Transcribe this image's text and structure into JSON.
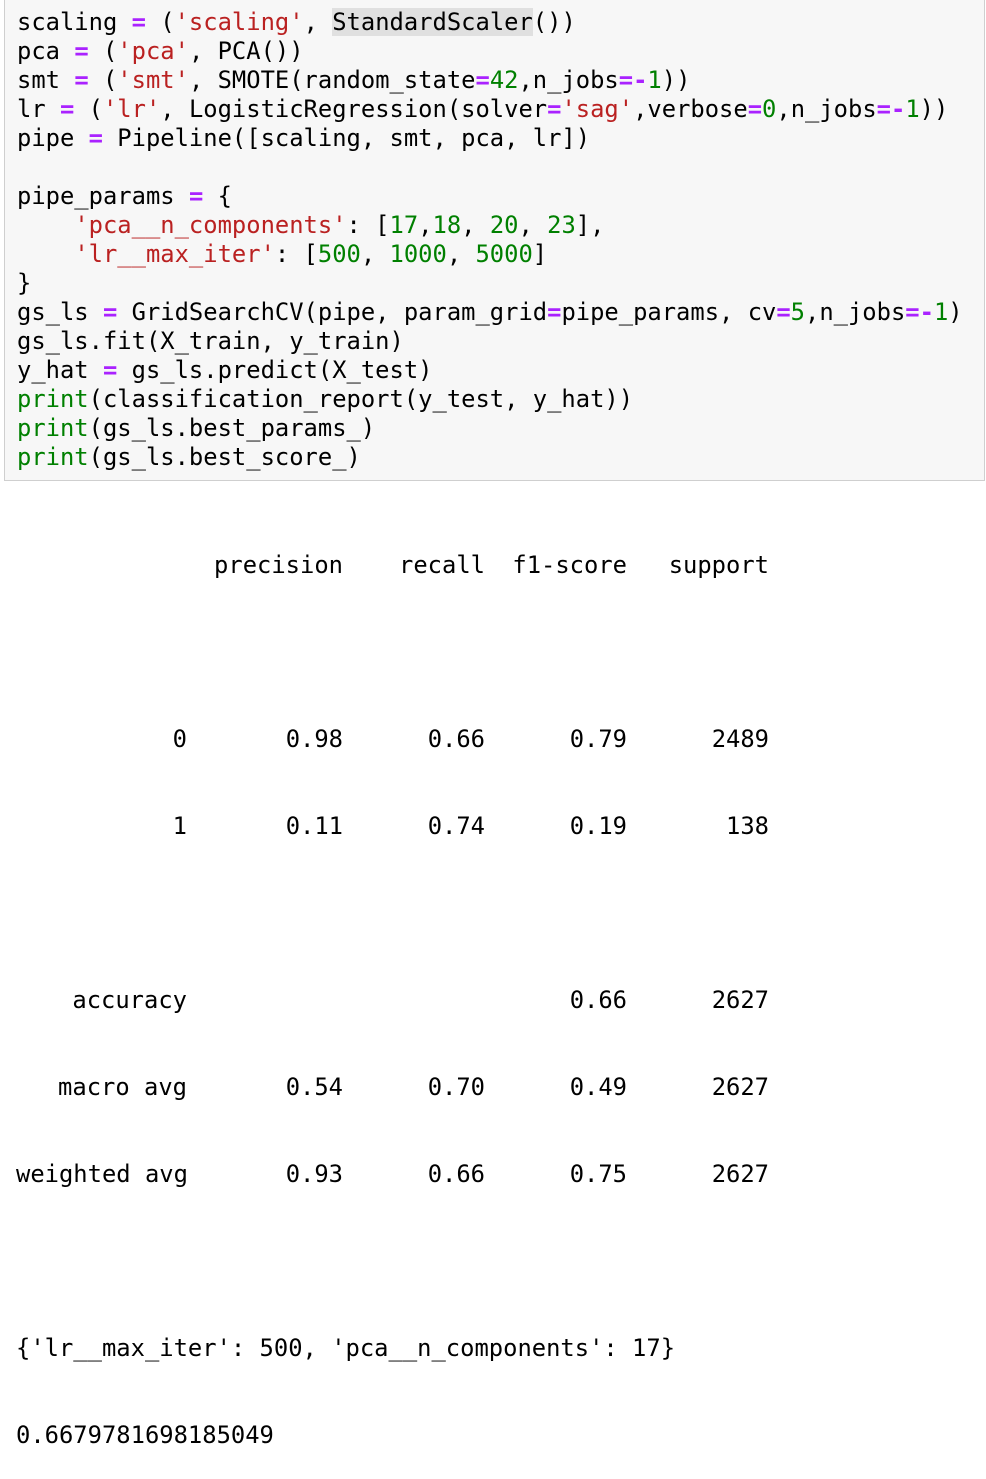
{
  "code": {
    "scaling": {
      "var": "scaling",
      "eq": "=",
      "open": " (",
      "str": "'scaling'",
      "sep": ", ",
      "obj": "StandardScaler",
      "close": "())"
    },
    "pca": {
      "var": "pca",
      "eq": "=",
      "open": " (",
      "str": "'pca'",
      "sep": ", ",
      "rest": "PCA())"
    },
    "smt": {
      "var": "smt",
      "eq": "=",
      "open": " (",
      "str": "'smt'",
      "sep": ", ",
      "call": "SMOTE(random_state",
      "eq2": "=",
      "num1": "42",
      "mid": ",n_jobs",
      "eq3": "=-",
      "num2": "1",
      "close": "))"
    },
    "lr": {
      "var": "lr",
      "eq": "=",
      "open": " (",
      "str": "'lr'",
      "sep": ", ",
      "call": "LogisticRegression(solver",
      "eq2": "=",
      "str2": "'sag'",
      "mid": ",verbose",
      "eq3": "=",
      "num1": "0",
      "mid2": ",n_jobs",
      "eq4": "=-",
      "num2": "1",
      "close": "))"
    },
    "pipe": {
      "var": "pipe",
      "eq": "=",
      "rest": " Pipeline([scaling, smt, pca, lr])"
    },
    "pipe_params_open": {
      "var": "pipe_params",
      "eq": "=",
      "rest": " {"
    },
    "param1": {
      "key": "'pca__n_components'",
      "colon": ": [",
      "v1": "17",
      "c1": ",",
      "v2": "18",
      "c2": ", ",
      "v3": "20",
      "c3": ", ",
      "v4": "23",
      "close": "],"
    },
    "param2": {
      "key": "'lr__max_iter'",
      "colon": ": [",
      "v1": "500",
      "c1": ", ",
      "v2": "1000",
      "c2": ", ",
      "v3": "5000",
      "close": "]"
    },
    "brace_close": "}",
    "gs": {
      "var": "gs_ls",
      "eq": "=",
      "call": " GridSearchCV(pipe, param_grid",
      "eq2": "=",
      "mid": "pipe_params, cv",
      "eq3": "=",
      "num1": "5",
      "mid2": ",n_jobs",
      "eq4": "=-",
      "num2": "1",
      "close": ")"
    },
    "fit": "gs_ls.fit(X_train, y_train)",
    "yhat": {
      "var": "y_hat",
      "eq": "=",
      "rest": " gs_ls.predict(X_test)"
    },
    "print1": {
      "kw": "print",
      "rest": "(classification_report(y_test, y_hat))"
    },
    "print2": {
      "kw": "print",
      "rest": "(gs_ls.best_params_)"
    },
    "print3": {
      "kw": "print",
      "rest": "(gs_ls.best_score_)"
    }
  },
  "report": {
    "headers": [
      "",
      "precision",
      "recall",
      "f1-score",
      "support"
    ],
    "rows": [
      [
        "0",
        "0.98",
        "0.66",
        "0.79",
        "2489"
      ],
      [
        "1",
        "0.11",
        "0.74",
        "0.19",
        "138"
      ],
      [
        "accuracy",
        "",
        "",
        "0.66",
        "2627"
      ],
      [
        "macro avg",
        "0.54",
        "0.70",
        "0.49",
        "2627"
      ],
      [
        "weighted avg",
        "0.93",
        "0.66",
        "0.75",
        "2627"
      ]
    ]
  },
  "best_params": "{'lr__max_iter': 500, 'pca__n_components': 17}",
  "best_score": "0.6679781698185049",
  "colors": {
    "string": "#ba2121",
    "number": "#008000",
    "operator": "#aa22ff",
    "keyword": "#008000",
    "cell_bg": "#f7f7f7"
  }
}
